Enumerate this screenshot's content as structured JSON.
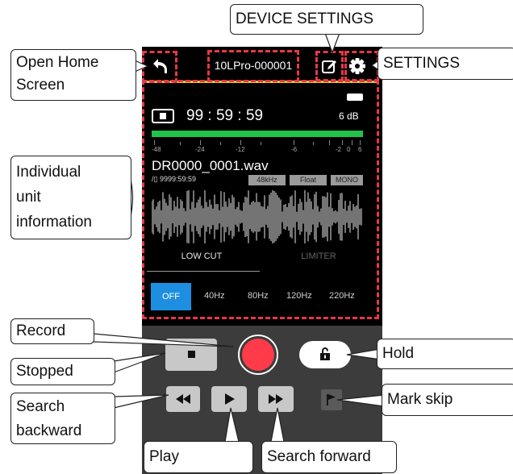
{
  "header": {
    "device_name": "10LPro-000001"
  },
  "status": {
    "time": "99 : 59 : 59",
    "level": "6 dB",
    "battery": "battery-icon"
  },
  "meter": {
    "scale": [
      "-48",
      "-24",
      "-12",
      "-6",
      "-2",
      "0",
      "6"
    ],
    "color": "#22c34a"
  },
  "file": {
    "name": "DR0000_0001.wav",
    "remaining": "9999:59:59",
    "sample_rate": "48kHz",
    "bit_depth": "Float",
    "channel": "MONO"
  },
  "tabs": {
    "low_cut": "LOW CUT",
    "limiter": "LIMITER"
  },
  "lowcut_options": [
    "OFF",
    "40Hz",
    "80Hz",
    "120Hz",
    "220Hz"
  ],
  "lowcut_selected": "OFF",
  "callouts": {
    "device_settings": "DEVICE SETTINGS",
    "open_home": "Open Home\nScreen",
    "settings": "SETTINGS",
    "individual": "Individual\nunit\ninformation",
    "record": "Record",
    "stopped": "Stopped",
    "hold": "Hold",
    "search_backward": "Search\nbackward",
    "mark_skip": "Mark skip",
    "play": "Play",
    "search_forward": "Search forward"
  },
  "colors": {
    "accent_red": "#e63946",
    "record": "#ff3b4a",
    "off_button": "#1e8fe0",
    "title_underline": "#e8c33a"
  }
}
